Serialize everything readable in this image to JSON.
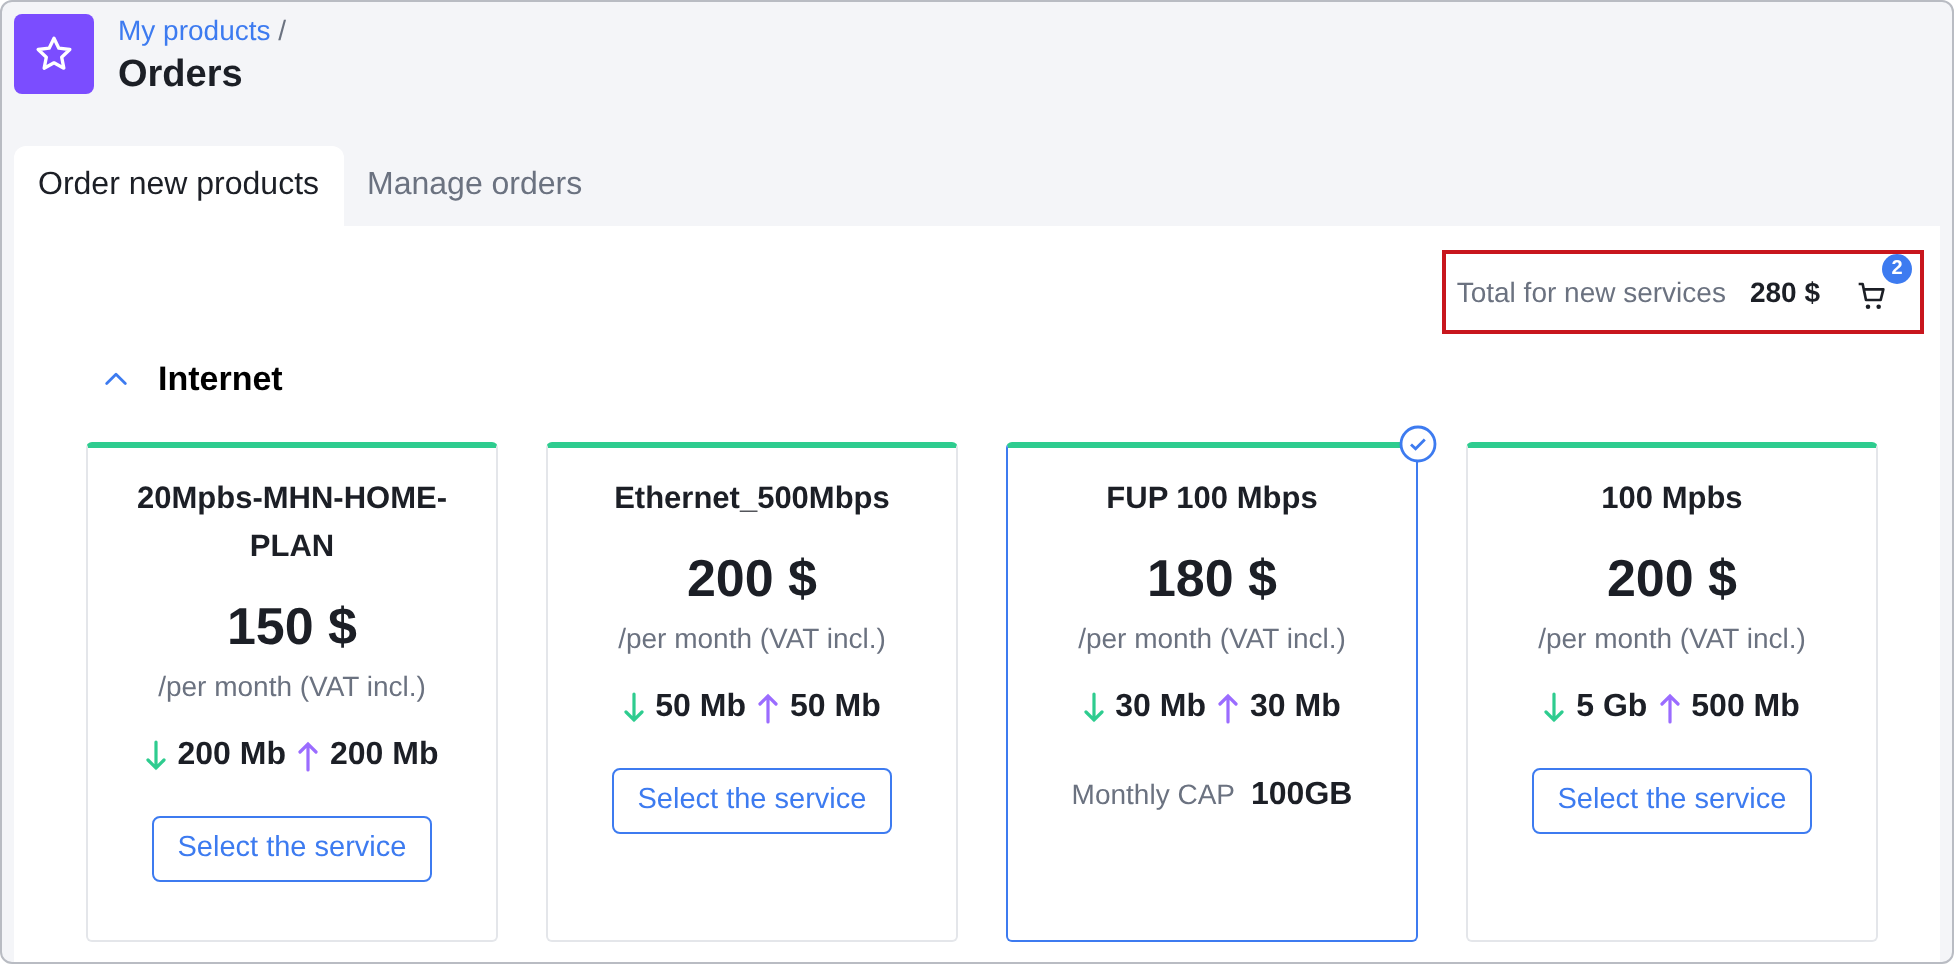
{
  "breadcrumb": {
    "link": "My products",
    "separator": "/"
  },
  "page_title": "Orders",
  "tabs": [
    {
      "label": "Order new products",
      "selected": true
    },
    {
      "label": "Manage orders",
      "selected": false
    }
  ],
  "summary": {
    "label": "Total for new services",
    "total": "280 $",
    "cart_count": "2"
  },
  "section": {
    "title": "Internet",
    "expanded": true
  },
  "plans": [
    {
      "name": "20Mpbs-MHN-HOME-PLAN",
      "price": "150 $",
      "period": "/per month (VAT incl.)",
      "download": "200 Mb",
      "upload": "200 Mb",
      "selected": false,
      "action": "Select the service"
    },
    {
      "name": "Ethernet_500Mbps",
      "price": "200 $",
      "period": "/per month (VAT incl.)",
      "download": "50 Mb",
      "upload": "50 Mb",
      "selected": false,
      "action": "Select the service"
    },
    {
      "name": "FUP 100 Mbps",
      "price": "180 $",
      "period": "/per month (VAT incl.)",
      "download": "30 Mb",
      "upload": "30 Mb",
      "selected": true,
      "cap_label": "Monthly CAP",
      "cap_value": "100GB"
    },
    {
      "name": "100 Mpbs",
      "price": "200 $",
      "period": "/per month (VAT incl.)",
      "download": "5 Gb",
      "upload": "500 Mb",
      "selected": false,
      "action": "Select the service"
    }
  ]
}
